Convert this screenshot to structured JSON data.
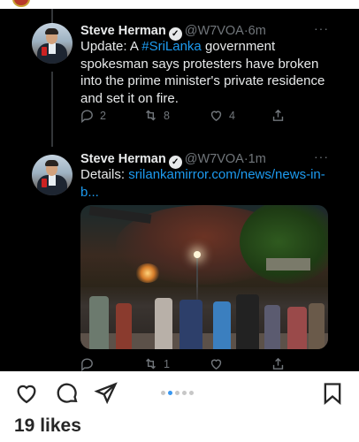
{
  "tweets": [
    {
      "name": "Steve Herman",
      "verified": "✓",
      "handle": "@W7VOA",
      "separator": "·",
      "time": "6m",
      "text_before": "Update: A ",
      "hashtag": "#SriLanka",
      "text_after": " government spokesman says protesters have broken into the prime minister's private residence and set it on fire.",
      "more": "···",
      "replies": "2",
      "retweets": "8",
      "likes": "4"
    },
    {
      "name": "Steve Herman",
      "verified": "✓",
      "handle": "@W7VOA",
      "separator": "·",
      "time": "1m",
      "text_before": "Details: ",
      "link": "srilankamirror.com/news/news-in-b...",
      "more": "···",
      "retweets": "1"
    }
  ],
  "instagram": {
    "carousel_count": 5,
    "carousel_active": 1,
    "likes_label": "19 likes"
  },
  "icons": [
    "heart-icon",
    "comment-icon",
    "send-icon",
    "bookmark-icon",
    "reply-icon",
    "retweet-icon",
    "like-icon",
    "share-icon"
  ],
  "colors": {
    "tweet_bg": "#000000",
    "tweet_text": "#e7e9ea",
    "muted": "#71767b",
    "link": "#1d9bf0",
    "carousel_active": "#3897f0"
  }
}
